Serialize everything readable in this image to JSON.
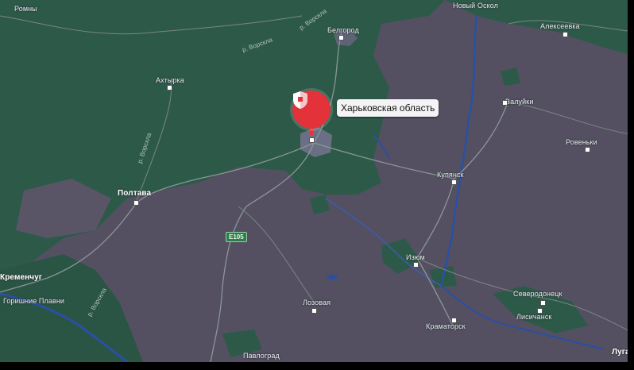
{
  "map": {
    "colors": {
      "land": "#545062",
      "forest": "#2d5a48",
      "water": "#2a4fa3",
      "road": "#7c8a8a",
      "marker": "#e3323a"
    },
    "region": {
      "label": "Харьковская область",
      "icon": "shield-icon"
    },
    "road_badge": "E105",
    "cities": {
      "belgorod": "Белгород",
      "akhtyrka": "Ахтырка",
      "poltava": "Полтава",
      "kupyansk": "Купянск",
      "izyum": "Изюм",
      "valuiki": "Валуйки",
      "alekseevka": "Алексеевка",
      "rovenki": "Ровеньки",
      "severodonetsk": "Северодонецк",
      "lisichansk": "Лисичанск",
      "kramatorsk": "Краматорск",
      "lozovaya": "Лозовая",
      "kremenchug": "Кременчуг",
      "gorishni_plavni": "Горишние Плавни",
      "pavlograd": "Павлоград",
      "lugansk": "Луган",
      "novy_oskol": "Новый Оскол",
      "rylsk_top": "Ромны"
    },
    "rivers": {
      "vorskla": "р. Ворскла",
      "psel": "р. Ворскла",
      "vorskla_side": "р. Ворскла",
      "vorskla_south": "р. Ворскла"
    }
  }
}
